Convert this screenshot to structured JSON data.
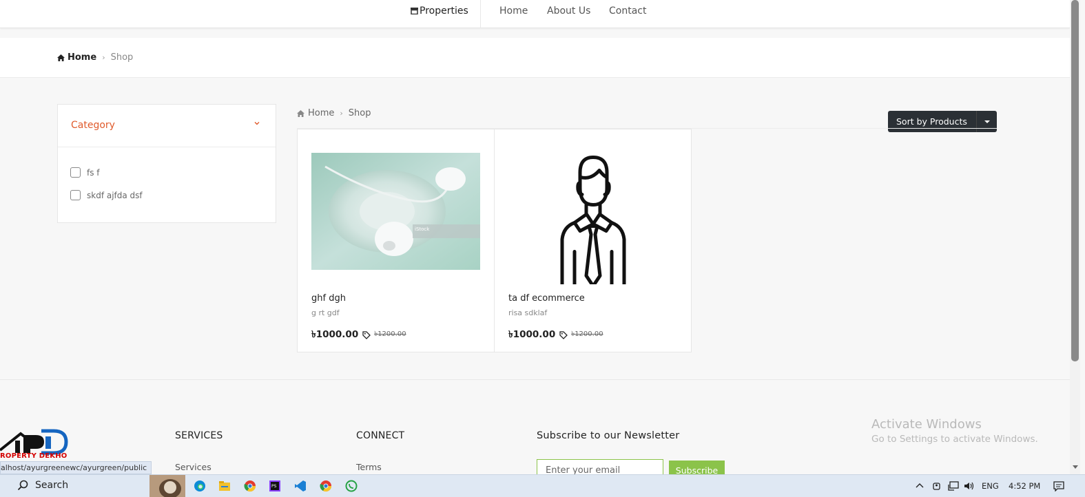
{
  "nav": {
    "brand": "Properties",
    "links": [
      "Home",
      "About Us",
      "Contact"
    ]
  },
  "breadcrumb": {
    "home": "Home",
    "current": "Shop"
  },
  "sidebar": {
    "title": "Category",
    "categories": [
      "fs f",
      "skdf ajfda dsf"
    ]
  },
  "shop_breadcrumb": {
    "home": "Home",
    "current": "Shop"
  },
  "sort": {
    "label": "Sort by Products"
  },
  "products": [
    {
      "name": "ghf dgh",
      "subtitle": "g rt gdf",
      "price": "৳1000.00",
      "old_price": "৳1200.00",
      "image": "earphones-photo"
    },
    {
      "name": "ta df ecommerce",
      "subtitle": "risa sdklaf",
      "price": "৳1000.00",
      "old_price": "৳1200.00",
      "image": "businessman-icon"
    }
  ],
  "footer": {
    "logo_text": "ROPERTY DEKHO",
    "services_heading": "SERVICES",
    "services_link": "Services",
    "connect_heading": "CONNECT",
    "connect_link": "Terms",
    "newsletter_heading": "Subscribe to our Newsletter",
    "email_placeholder": "Enter your email",
    "subscribe_label": "Subscribe"
  },
  "status_url": "alhost/ayurgreenewc/ayurgreen/public",
  "windows_watermark": {
    "line1": "Activate Windows",
    "line2": "Go to Settings to activate Windows."
  },
  "taskbar": {
    "search_label": "Search",
    "language": "ENG",
    "time": "4:52 PM"
  },
  "colors": {
    "accent_orange": "#e05a2b",
    "accent_green": "#8bc34a",
    "sort_button": "#2b3035"
  }
}
